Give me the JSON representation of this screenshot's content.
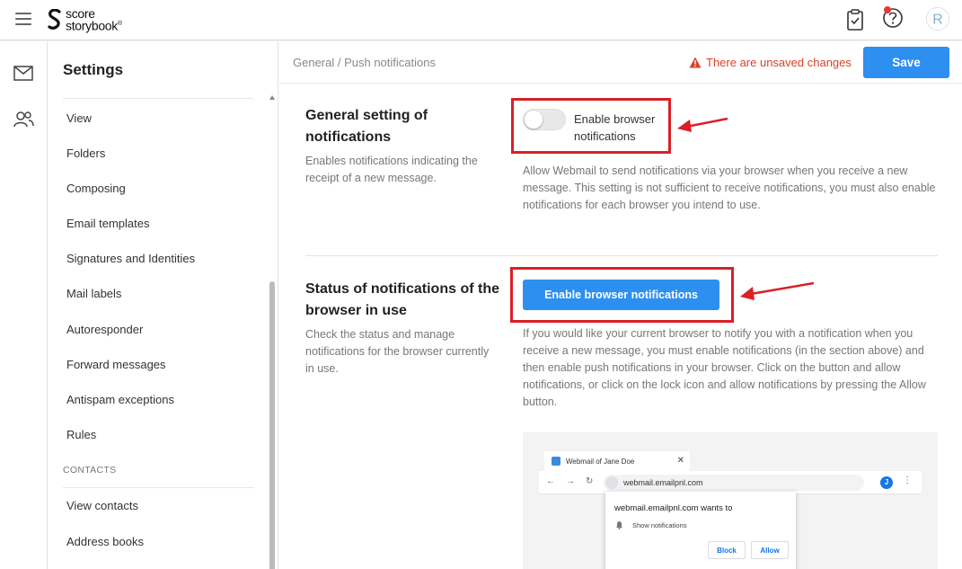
{
  "app": {
    "logo_line1": "score",
    "logo_line2": "storybook",
    "logo_mark": "®",
    "avatar_letter": "R"
  },
  "topbar": {
    "icons": [
      "hamburger-menu-icon",
      "clipboard-check-icon",
      "help-notification-icon",
      "user-avatar"
    ]
  },
  "rail": {
    "icons": [
      "mail-icon",
      "contacts-icon"
    ]
  },
  "sidebar": {
    "title": "Settings",
    "items": [
      {
        "label": "View"
      },
      {
        "label": "Folders"
      },
      {
        "label": "Composing"
      },
      {
        "label": "Email templates"
      },
      {
        "label": "Signatures and Identities"
      },
      {
        "label": "Mail labels"
      },
      {
        "label": "Autoresponder"
      },
      {
        "label": "Forward messages"
      },
      {
        "label": "Antispam exceptions"
      },
      {
        "label": "Rules"
      }
    ],
    "contacts_section": "CONTACTS",
    "contacts_items": [
      {
        "label": "View contacts"
      },
      {
        "label": "Address books"
      }
    ]
  },
  "header": {
    "breadcrumb": "General / Push notifications",
    "unsaved": "There are unsaved changes",
    "save_label": "Save"
  },
  "section1": {
    "title": "General setting of notifications",
    "desc": "Enables notifications indicating the receipt of a new message.",
    "toggle_label": "Enable browser notifications",
    "toggle_on": false,
    "help": "Allow Webmail to send notifications via your browser when you receive a new message. This setting is not sufficient to receive notifications, you must also enable notifications for each browser you intend to use."
  },
  "section2": {
    "title": "Status of notifications of the browser in use",
    "desc": "Check the status and manage notifications for the browser currently in use.",
    "button_label": "Enable browser notifications",
    "help": "If you would like your current browser to notify you with a notification when you receive a new message, you must enable notifications (in the section above) and then enable push notifications in your browser. Click on the button and allow notifications, or click on the lock icon and allow notifications by pressing the Allow button."
  },
  "preview": {
    "tab_label": "Webmail of Jane Doe",
    "tab_close": "✕",
    "url": "webmail.emailpnl.com",
    "avatar_letter": "J",
    "popup_title": "webmail.emailpnl.com wants to",
    "popup_row": "Show notifications",
    "block_label": "Block",
    "allow_label": "Allow"
  },
  "colors": {
    "accent": "#2d8ff0",
    "warning": "#d9412b",
    "annotation": "#d92027"
  }
}
